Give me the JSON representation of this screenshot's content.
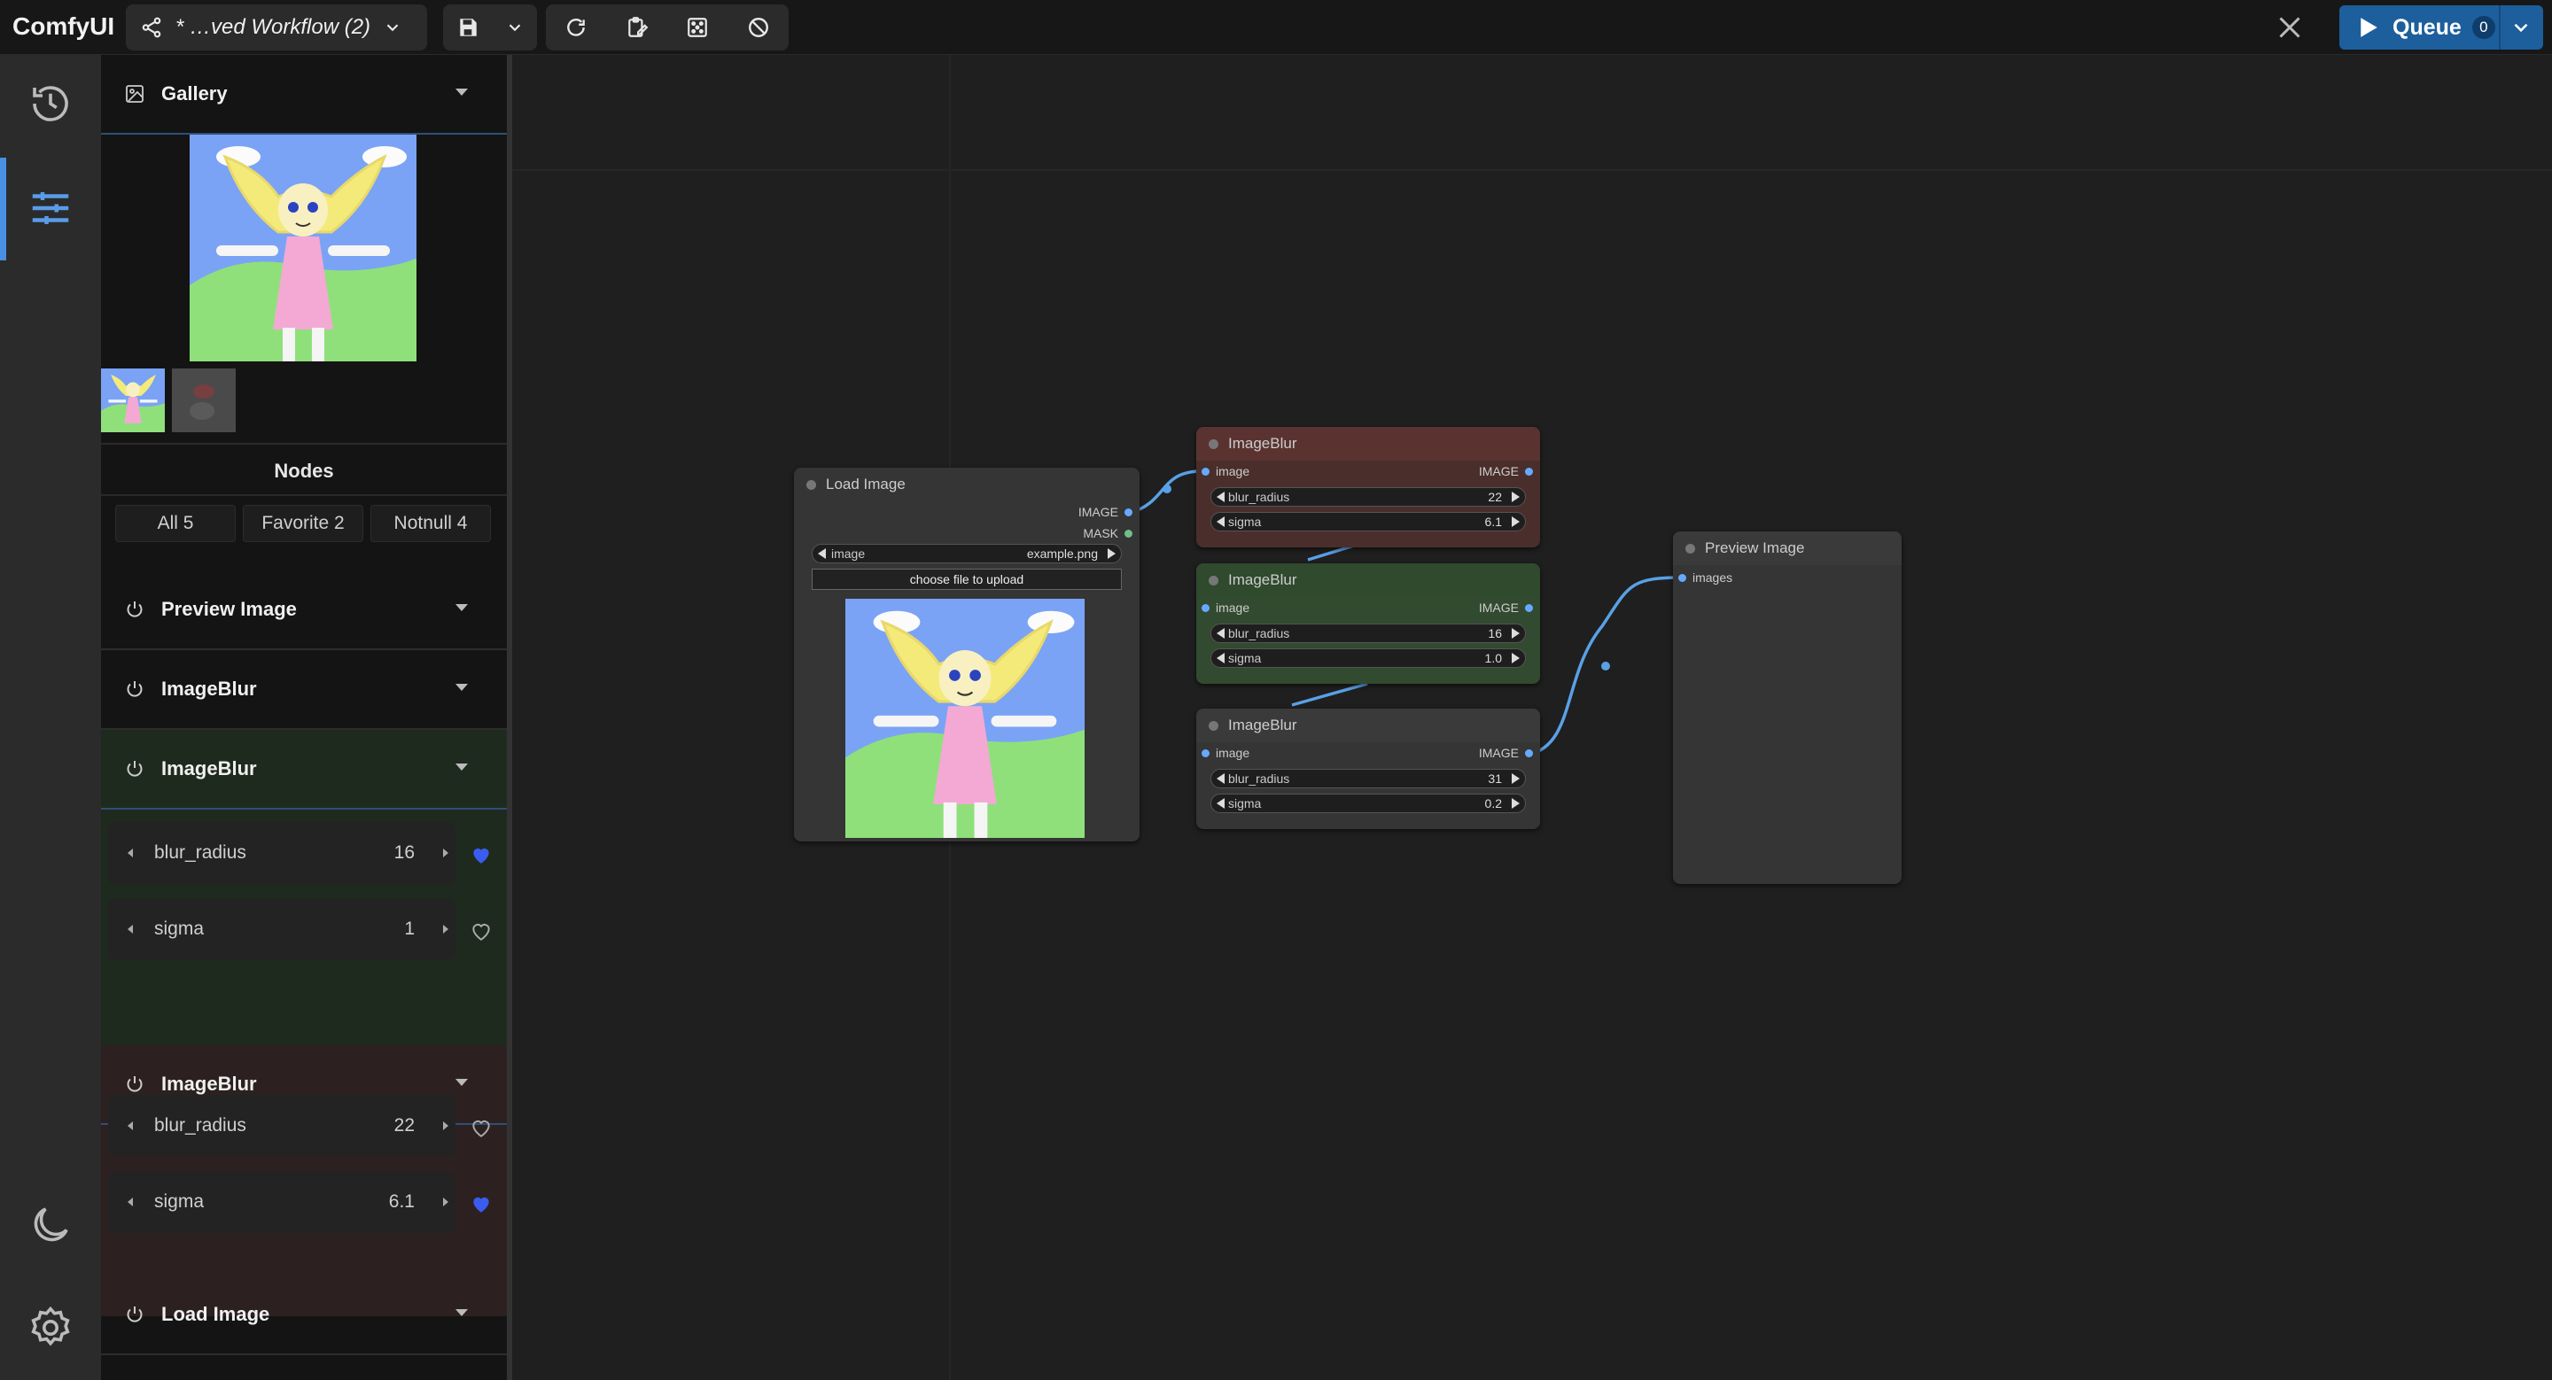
{
  "app": {
    "brand": "ComfyUI"
  },
  "toolbar": {
    "workflow_title": "* …ved Workflow (2)",
    "queue_label": "Queue",
    "queue_count": "0"
  },
  "panel": {
    "gallery_label": "Gallery",
    "nodes_title": "Nodes",
    "filters": [
      "All 5",
      "Favorite 2",
      "Notnull 4"
    ],
    "sections": [
      {
        "label": "Preview Image",
        "bg": "#141414"
      },
      {
        "label": "ImageBlur",
        "bg": "#141414"
      },
      {
        "label": "ImageBlur",
        "bg": "#1f2a1e",
        "widgets": [
          {
            "name": "blur_radius",
            "value": "16",
            "favorite": true
          },
          {
            "name": "sigma",
            "value": "1",
            "favorite": false
          }
        ]
      },
      {
        "label": "ImageBlur",
        "bg": "#2c2120",
        "widgets": [
          {
            "name": "blur_radius",
            "value": "22",
            "favorite": false
          },
          {
            "name": "sigma",
            "value": "6.1",
            "favorite": true
          }
        ]
      },
      {
        "label": "Load Image",
        "bg": "#141414"
      }
    ]
  },
  "canvas": {
    "load_image": {
      "title": "Load Image",
      "outputs": [
        "IMAGE",
        "MASK"
      ],
      "image_widget": {
        "name": "image",
        "value": "example.png"
      },
      "upload_button": "choose file to upload"
    },
    "blur_nodes": [
      {
        "title": "ImageBlur",
        "input": "image",
        "output": "IMAGE",
        "blur_radius": "22",
        "sigma": "6.1",
        "color": "#5a3330",
        "body": "#4a2e2b"
      },
      {
        "title": "ImageBlur",
        "input": "image",
        "output": "IMAGE",
        "blur_radius": "16",
        "sigma": "1.0",
        "color": "#2f4a2d",
        "body": "#324a30"
      },
      {
        "title": "ImageBlur",
        "input": "image",
        "output": "IMAGE",
        "blur_radius": "31",
        "sigma": "0.2",
        "color": "#353535",
        "body": "#353535"
      }
    ],
    "preview_image": {
      "title": "Preview Image",
      "input": "images"
    }
  },
  "colors": {
    "accent": "#4a90e2",
    "queue_button": "#1d5e9c",
    "link": "#5aa0e6",
    "favorite": "#3b5cf0"
  },
  "icons": {
    "workflow": "share-icon",
    "save": "save-icon",
    "refresh": "refresh-icon",
    "clipboard": "clipboard-edit-icon",
    "fit": "fit-view-icon",
    "cancel": "cancel-icon",
    "history": "history-icon",
    "node_library": "sliders-icon",
    "theme": "moon-icon",
    "settings": "gear-icon"
  }
}
